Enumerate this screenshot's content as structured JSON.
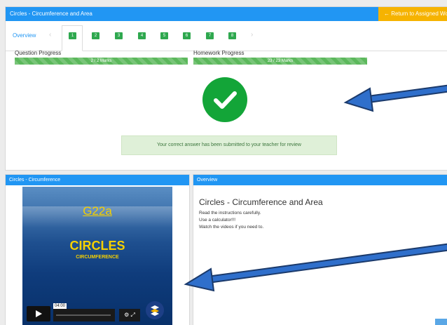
{
  "top_panel": {
    "title": "Circles - Circumference and Area",
    "return_label": "← Return to Assigned Work",
    "tabs": {
      "overview_label": "Overview",
      "numbers": [
        "1",
        "2",
        "3",
        "4",
        "5",
        "6",
        "7",
        "8"
      ]
    },
    "question_progress": {
      "label": "Question Progress",
      "text": "2 / 2 Marks",
      "fraction": 1.0
    },
    "homework_progress": {
      "label": "Homework Progress",
      "text": "23 / 23 Marks",
      "fraction": 1.0
    },
    "success_message": "Your correct answer has been submitted to your teacher for review"
  },
  "video_panel": {
    "title": "Circles - Circumference",
    "video": {
      "code": "G22a",
      "title": "CIRCLES",
      "subtitle": "CIRCUMFERENCE",
      "time": "04:00"
    }
  },
  "overview_panel": {
    "header": "Overview",
    "title": "Circles - Circumference and Area",
    "lines": [
      "Read the instructions carefully.",
      "Use a calculator!!!",
      "Watch the videos if you need to."
    ]
  },
  "colors": {
    "header_blue": "#2196f3",
    "return_orange": "#f6b300",
    "progress_green": "#5cb85c",
    "check_green": "#13a538",
    "arrow_blue": "#2f6fcb"
  }
}
